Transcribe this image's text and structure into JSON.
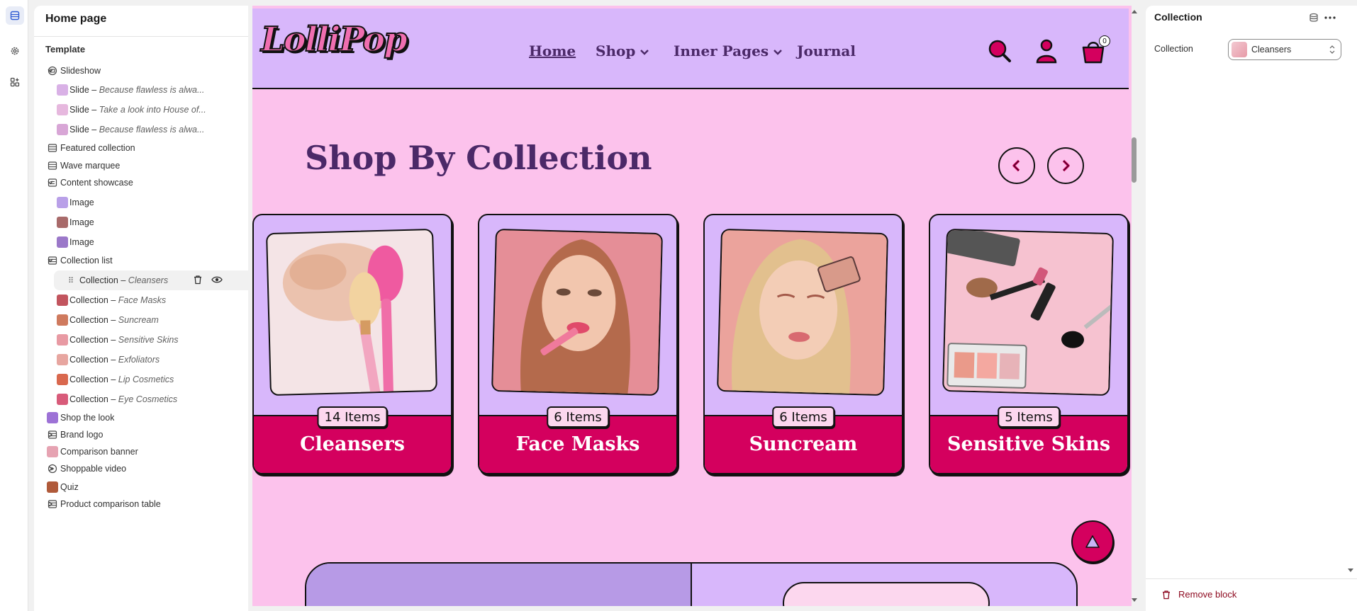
{
  "sidebar": {
    "title": "Home page",
    "section": "Template",
    "rows": [
      {
        "name": "tree-slideshow",
        "label": "Slideshow",
        "italic": "",
        "type": "group",
        "expanded": true,
        "icon": "slideshow-icon"
      },
      {
        "name": "tree-slide-1",
        "label": "Slide – ",
        "italic": "Because flawless is alwa...",
        "type": "child",
        "thumb": "#d9b1e6"
      },
      {
        "name": "tree-slide-2",
        "label": "Slide – ",
        "italic": "Take a look into House of...",
        "type": "child",
        "thumb": "#e6b8de"
      },
      {
        "name": "tree-slide-3",
        "label": "Slide – ",
        "italic": "Because flawless is alwa...",
        "type": "child",
        "thumb": "#d8a6d6"
      },
      {
        "name": "tree-featured-collection",
        "label": "Featured collection",
        "italic": "",
        "type": "section",
        "icon": "section-icon"
      },
      {
        "name": "tree-wave-marquee",
        "label": "Wave marquee",
        "italic": "",
        "type": "section",
        "icon": "section-icon"
      },
      {
        "name": "tree-content-showcase",
        "label": "Content showcase",
        "italic": "",
        "type": "group",
        "expanded": true,
        "icon": "showcase-icon"
      },
      {
        "name": "tree-image-1",
        "label": "Image",
        "italic": "",
        "type": "child",
        "thumb": "#b9a0e8"
      },
      {
        "name": "tree-image-2",
        "label": "Image",
        "italic": "",
        "type": "child",
        "thumb": "#a86a6a"
      },
      {
        "name": "tree-image-3",
        "label": "Image",
        "italic": "",
        "type": "child",
        "thumb": "#9b78c9"
      },
      {
        "name": "tree-collection-list",
        "label": "Collection list",
        "italic": "",
        "type": "group",
        "expanded": true,
        "icon": "section-icon"
      },
      {
        "name": "tree-collection-cleansers",
        "label": "Collection – ",
        "italic": "Cleansers",
        "type": "selected"
      },
      {
        "name": "tree-collection-face-masks",
        "label": "Collection – ",
        "italic": "Face Masks",
        "type": "child",
        "thumb": "#c2555e"
      },
      {
        "name": "tree-collection-suncream",
        "label": "Collection – ",
        "italic": "Suncream",
        "type": "child",
        "thumb": "#cf7a5e"
      },
      {
        "name": "tree-collection-sensitive-skins",
        "label": "Collection – ",
        "italic": "Sensitive Skins",
        "type": "child",
        "thumb": "#e89aa3"
      },
      {
        "name": "tree-collection-exfoliators",
        "label": "Collection – ",
        "italic": "Exfoliators",
        "type": "child",
        "thumb": "#e7a6a0"
      },
      {
        "name": "tree-collection-lip-cosmetics",
        "label": "Collection – ",
        "italic": "Lip Cosmetics",
        "type": "child",
        "thumb": "#d9684e"
      },
      {
        "name": "tree-collection-eye-cosmetics",
        "label": "Collection – ",
        "italic": "Eye Cosmetics",
        "type": "child",
        "thumb": "#d85b7a"
      },
      {
        "name": "tree-shop-the-look",
        "label": "Shop the look",
        "italic": "",
        "type": "collapsed",
        "thumb": "#9d72d6"
      },
      {
        "name": "tree-brand-logo",
        "label": "Brand logo",
        "italic": "",
        "type": "collapsed",
        "icon": "section-icon"
      },
      {
        "name": "tree-comparison-banner",
        "label": "Comparison banner",
        "italic": "",
        "type": "plain",
        "thumb": "#e6a3b2"
      },
      {
        "name": "tree-shoppable-video",
        "label": "Shoppable video",
        "italic": "",
        "type": "collapsed",
        "icon": "play-icon"
      },
      {
        "name": "tree-quiz",
        "label": "Quiz",
        "italic": "",
        "type": "collapsed",
        "thumb": "#b05a3a"
      },
      {
        "name": "tree-product-comparison-table",
        "label": "Product comparison table",
        "italic": "",
        "type": "collapsed",
        "icon": "section-icon"
      }
    ]
  },
  "preview": {
    "logo": "LolliPop",
    "nav": {
      "home": "Home",
      "shop": "Shop",
      "inner_pages": "Inner Pages",
      "journal": "Journal"
    },
    "cart_count": "0",
    "section_title": "Shop By Collection",
    "collections": [
      {
        "name": "Cleansers",
        "count": "14 Items",
        "photo": "brushes"
      },
      {
        "name": "Face Masks",
        "count": "6 Items",
        "photo": "portrait-lipstick"
      },
      {
        "name": "Suncream",
        "count": "6 Items",
        "photo": "portrait-eyeshadow"
      },
      {
        "name": "Sensitive Skins",
        "count": "5 Items",
        "photo": "flatlay"
      }
    ]
  },
  "right_panel": {
    "title": "Collection",
    "field_label": "Collection",
    "selected_value": "Cleansers",
    "remove_label": "Remove block"
  },
  "colors": {
    "nav_bg": "#d8b7fb",
    "page_bg": "#fcc2ec",
    "accent": "#d4005e",
    "heading": "#4b2968",
    "danger": "#8e0b21"
  }
}
